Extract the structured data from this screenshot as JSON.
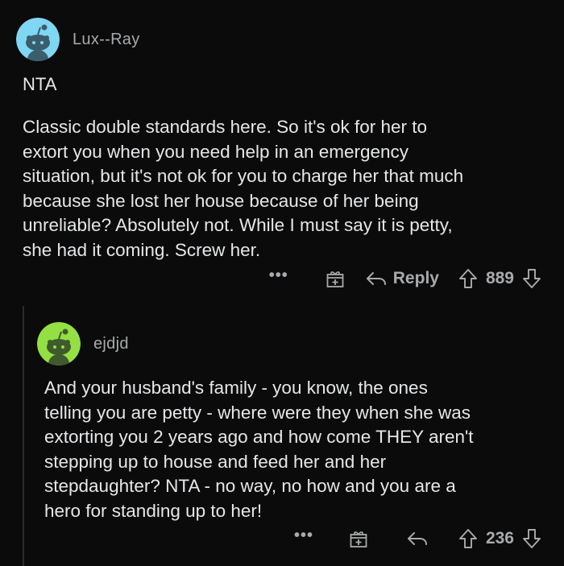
{
  "comments": [
    {
      "username": "Lux--Ray",
      "tag": "NTA",
      "body": "Classic double standards here. So it's ok for her to\nextort you when you need help in an emergency\nsituation, but it's not ok for you to charge her that much\nbecause she lost her house because of her being\nunreliable? Absolutely not. While I must say it is petty,\nshe had it coming. Screw her.",
      "more": "•••",
      "reply_label": "Reply",
      "score": "889",
      "avatar_color": "#7fd7f4"
    },
    {
      "username": "ejdjd",
      "body": "And your husband's family - you know, the ones\ntelling you are petty - where were they when she was\nextorting you 2 years ago and how come THEY aren't\nstepping up to house and feed her and her\nstepdaughter?  NTA - no way, no how and you are a\nhero for standing up to her!",
      "more": "•••",
      "score": "236",
      "avatar_color": "#94e044"
    }
  ],
  "icons": {
    "avatar": "reddit-snoo-icon",
    "gift": "gift-icon",
    "reply": "reply-arrow-icon",
    "upvote": "upvote-arrow-icon",
    "downvote": "downvote-arrow-icon"
  }
}
